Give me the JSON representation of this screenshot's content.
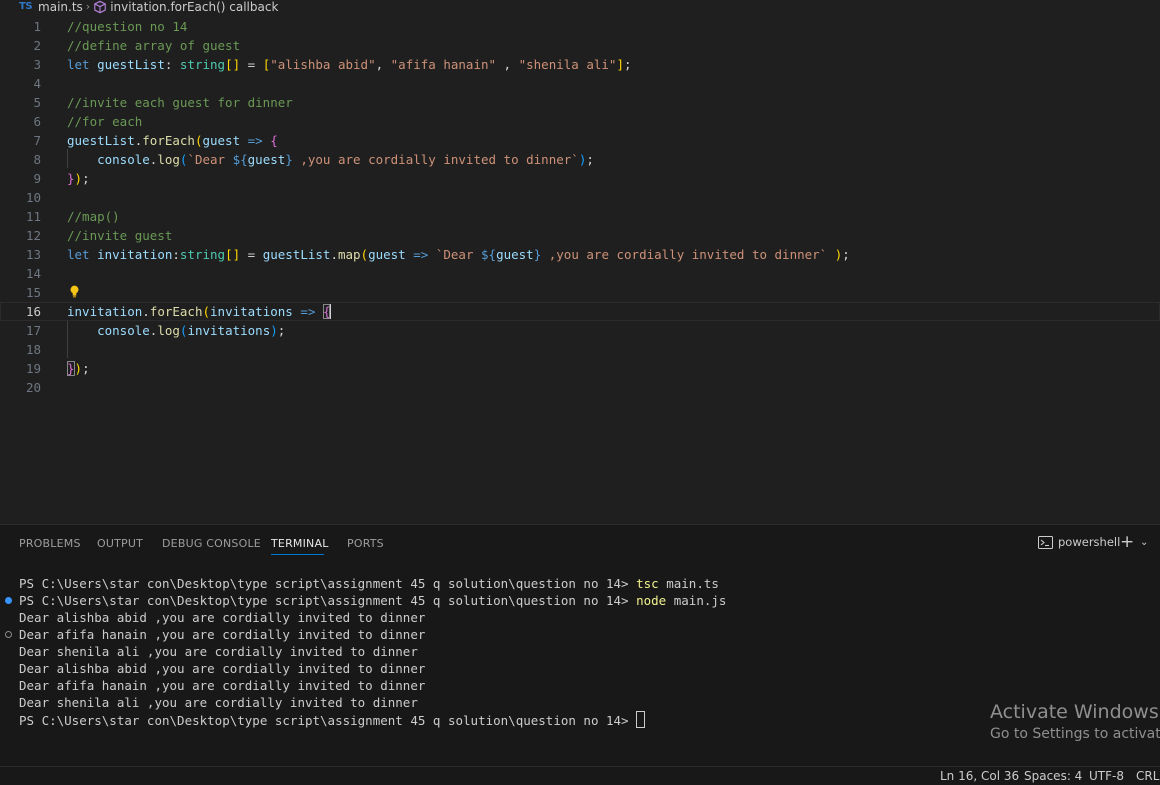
{
  "breadcrumb": {
    "lang_badge": "TS",
    "file": "main.ts",
    "symbol": "invitation.forEach() callback"
  },
  "editor": {
    "current_line": 16,
    "lines": [
      {
        "n": "1",
        "t": "//question no 14"
      },
      {
        "n": "2",
        "t": "//define array of guest"
      },
      {
        "n": "3",
        "t": "let guestList: string[] = [\"alishba abid\", \"afifa hanain\" , \"shenila ali\"];"
      },
      {
        "n": "4",
        "t": ""
      },
      {
        "n": "5",
        "t": "//invite each guest for dinner"
      },
      {
        "n": "6",
        "t": "//for each"
      },
      {
        "n": "7",
        "t": "guestList.forEach(guest => {"
      },
      {
        "n": "8",
        "t": "    console.log(`Dear ${guest} ,you are cordially invited to dinner`);"
      },
      {
        "n": "9",
        "t": "});"
      },
      {
        "n": "10",
        "t": ""
      },
      {
        "n": "11",
        "t": "//map()"
      },
      {
        "n": "12",
        "t": "//invite guest"
      },
      {
        "n": "13",
        "t": "let invitation:string[] = guestList.map(guest => `Dear ${guest} ,you are cordially invited to dinner` );"
      },
      {
        "n": "14",
        "t": ""
      },
      {
        "n": "15",
        "t": ""
      },
      {
        "n": "16",
        "t": "invitation.forEach(invitations => {"
      },
      {
        "n": "17",
        "t": "    console.log(invitations);"
      },
      {
        "n": "18",
        "t": ""
      },
      {
        "n": "19",
        "t": "});"
      },
      {
        "n": "20",
        "t": ""
      }
    ]
  },
  "panel": {
    "tabs": [
      "PROBLEMS",
      "OUTPUT",
      "DEBUG CONSOLE",
      "TERMINAL",
      "PORTS"
    ],
    "active_tab": "TERMINAL",
    "shell_name": "powershell",
    "add_label": "+",
    "dropdown_label": "⌄"
  },
  "terminal": {
    "prompt": "PS C:\\Users\\star con\\Desktop\\type script\\assignment 45 q solution\\question no 14> ",
    "lines": [
      {
        "kind": "cmd",
        "cmd": "tsc",
        "arg": " main.ts",
        "mark": ""
      },
      {
        "kind": "cmd",
        "cmd": "node",
        "arg": " main.js",
        "mark": "ok"
      },
      {
        "kind": "out",
        "text": "Dear alishba abid ,you are cordially invited to dinner",
        "mark": ""
      },
      {
        "kind": "out",
        "text": "Dear afifa hanain ,you are cordially invited to dinner",
        "mark": "empty"
      },
      {
        "kind": "out",
        "text": "Dear shenila ali ,you are cordially invited to dinner",
        "mark": ""
      },
      {
        "kind": "out",
        "text": "Dear alishba abid ,you are cordially invited to dinner",
        "mark": ""
      },
      {
        "kind": "out",
        "text": "Dear afifa hanain ,you are cordially invited to dinner",
        "mark": ""
      },
      {
        "kind": "out",
        "text": "Dear shenila ali ,you are cordially invited to dinner",
        "mark": ""
      },
      {
        "kind": "prompt",
        "mark": ""
      }
    ]
  },
  "watermark": {
    "title": "Activate Windows",
    "subtitle": "Go to Settings to activate"
  },
  "statusbar": {
    "position": "Ln 16, Col 36",
    "spaces": "Spaces: 4",
    "encoding": "UTF-8",
    "eol": "CRLF"
  },
  "colors": {
    "background": "#1f1f1f",
    "comment": "#6a9955",
    "keyword": "#569cd6",
    "variable": "#9cdcfe",
    "type": "#4ec9b0",
    "function": "#dcdcaa",
    "string": "#ce9178",
    "accent": "#0078d4"
  }
}
